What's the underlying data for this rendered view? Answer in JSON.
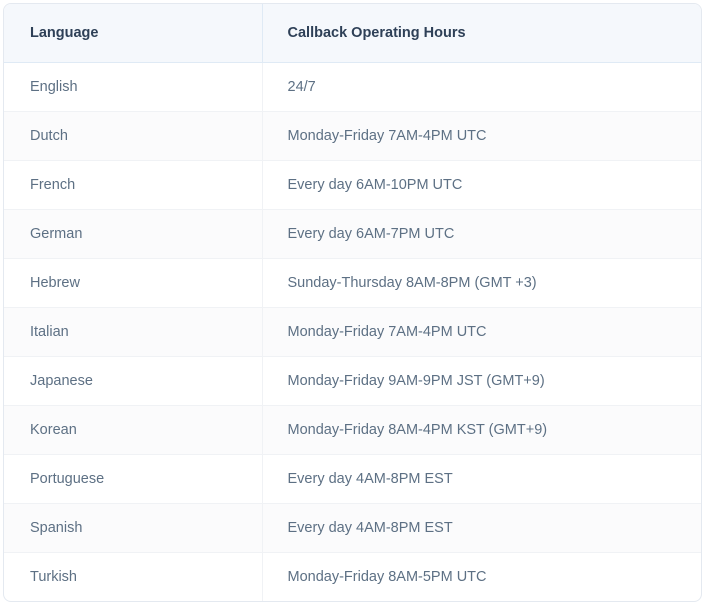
{
  "table": {
    "name": "callback-operating-hours-table",
    "columns": [
      {
        "key": "language",
        "label": "Language"
      },
      {
        "key": "hours",
        "label": "Callback Operating Hours"
      }
    ],
    "rows": [
      {
        "language": "English",
        "hours": "24/7"
      },
      {
        "language": "Dutch",
        "hours": "Monday-Friday 7AM-4PM UTC"
      },
      {
        "language": "French",
        "hours": "Every day 6AM-10PM UTC"
      },
      {
        "language": "German",
        "hours": "Every day 6AM-7PM UTC"
      },
      {
        "language": "Hebrew",
        "hours": "Sunday-Thursday 8AM-8PM (GMT +3)"
      },
      {
        "language": "Italian",
        "hours": "Monday-Friday 7AM-4PM UTC"
      },
      {
        "language": "Japanese",
        "hours": "Monday-Friday 9AM-9PM JST (GMT+9)"
      },
      {
        "language": "Korean",
        "hours": "Monday-Friday 8AM-4PM KST (GMT+9)"
      },
      {
        "language": "Portuguese",
        "hours": "Every day 4AM-8PM EST"
      },
      {
        "language": "Spanish",
        "hours": "Every day 4AM-8PM EST"
      },
      {
        "language": "Turkish",
        "hours": "Monday-Friday 8AM-5PM UTC"
      }
    ],
    "row_count": 11
  },
  "colors": {
    "header_background": "#f5f8fc",
    "header_text": "#2e4057",
    "body_text": "#5d7084",
    "row_alt_background": "#fbfbfc",
    "border": "#e4e9f0",
    "header_divider": "#dfeaf5",
    "row_divider": "#f0f2f5",
    "page_background": "#ffffff"
  }
}
